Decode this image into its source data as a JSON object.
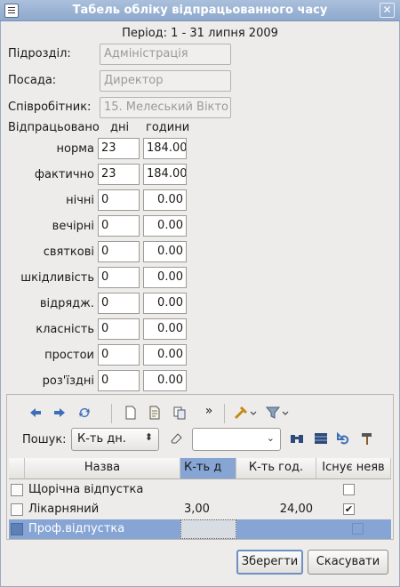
{
  "window": {
    "title": "Табель обліку відпрацьованного часу",
    "close_glyph": "✕"
  },
  "period": "Період: 1 - 31 липня 2009",
  "fields": {
    "department": {
      "label": "Підрозділ:",
      "value": "Адміністрація"
    },
    "position": {
      "label": "Посада:",
      "value": "Директор"
    },
    "employee": {
      "label": "Співробітник:",
      "value": "15. Мелеський Вікто"
    }
  },
  "worked_header": {
    "title": "Відпрацьовано",
    "days": "дні",
    "hours": "години"
  },
  "rows": [
    {
      "label": "норма",
      "days": "23",
      "hours": "184.00"
    },
    {
      "label": "фактично",
      "days": "23",
      "hours": "184.00"
    },
    {
      "label": "нічні",
      "days": "0",
      "hours": "0.00"
    },
    {
      "label": "вечірні",
      "days": "0",
      "hours": "0.00"
    },
    {
      "label": "святкові",
      "days": "0",
      "hours": "0.00"
    },
    {
      "label": "шкідливість",
      "days": "0",
      "hours": "0.00"
    },
    {
      "label": "відрядж.",
      "days": "0",
      "hours": "0.00"
    },
    {
      "label": "класність",
      "days": "0",
      "hours": "0.00"
    },
    {
      "label": "простои",
      "days": "0",
      "hours": "0.00"
    },
    {
      "label": "роз'їздні",
      "days": "0",
      "hours": "0.00"
    }
  ],
  "toolbar": {
    "icons": [
      "back-arrow-icon",
      "forward-arrow-icon",
      "refresh-icon",
      "new-document-icon",
      "edit-document-icon",
      "copy-document-icon",
      "more-icon",
      "tools-icon",
      "filter-icon"
    ],
    "more_glyph": "»",
    "search_label": "Пошук:",
    "search_field_value": "К-ть дн.",
    "search_value": ""
  },
  "table": {
    "columns": [
      "Назва",
      "К-ть д",
      "К-ть год.",
      "Існує неяв"
    ],
    "rows": [
      {
        "name": "Щорічна відпустка",
        "days": "",
        "hours": "",
        "exists": false
      },
      {
        "name": "Лікарняний",
        "days": "3,00",
        "hours": "24,00",
        "exists": true
      },
      {
        "name": "Проф.відпустка",
        "days": "",
        "hours": "",
        "exists": false
      }
    ],
    "selected_row": 2,
    "check_glyph": "✔"
  },
  "buttons": {
    "save": "Зберегти",
    "cancel": "Скасувати"
  },
  "colors": {
    "selection": "#86a5d4",
    "titlebar": "#9db4d4"
  }
}
